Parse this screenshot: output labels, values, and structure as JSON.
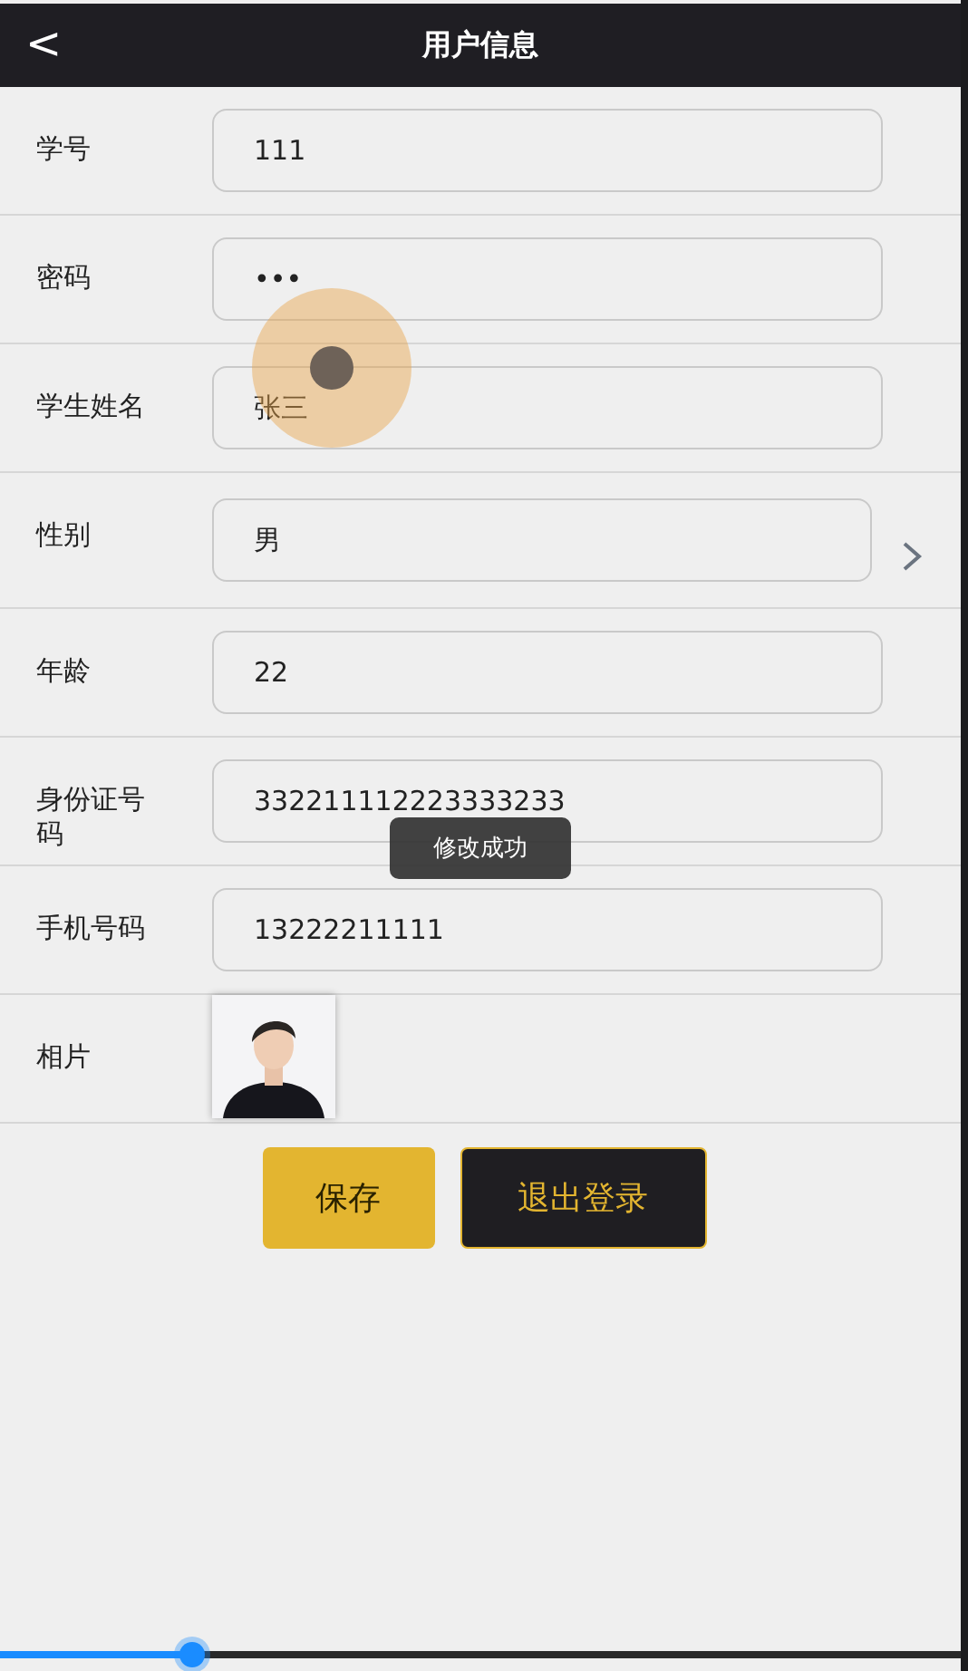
{
  "header": {
    "back": "<",
    "title": "用户信息"
  },
  "fields": [
    {
      "kind": "text",
      "label": "学号",
      "value": "111"
    },
    {
      "kind": "text",
      "label": "密码",
      "value": "•••"
    },
    {
      "kind": "text",
      "label": "学生姓名",
      "value": "张三"
    },
    {
      "kind": "select",
      "label": "性别",
      "value": "男"
    },
    {
      "kind": "text",
      "label": "年龄",
      "value": "22"
    },
    {
      "kind": "text",
      "label": "身份证号码",
      "value": "332211112223333233"
    },
    {
      "kind": "text",
      "label": "手机号码",
      "value": "13222211111"
    },
    {
      "label": "相片"
    }
  ],
  "buttons": [
    {
      "kind": "primary",
      "label": "保存"
    },
    {
      "kind": "dark",
      "label": "退出登录"
    }
  ],
  "toast": "修改成功",
  "video_progress": {
    "level": 0.2
  }
}
